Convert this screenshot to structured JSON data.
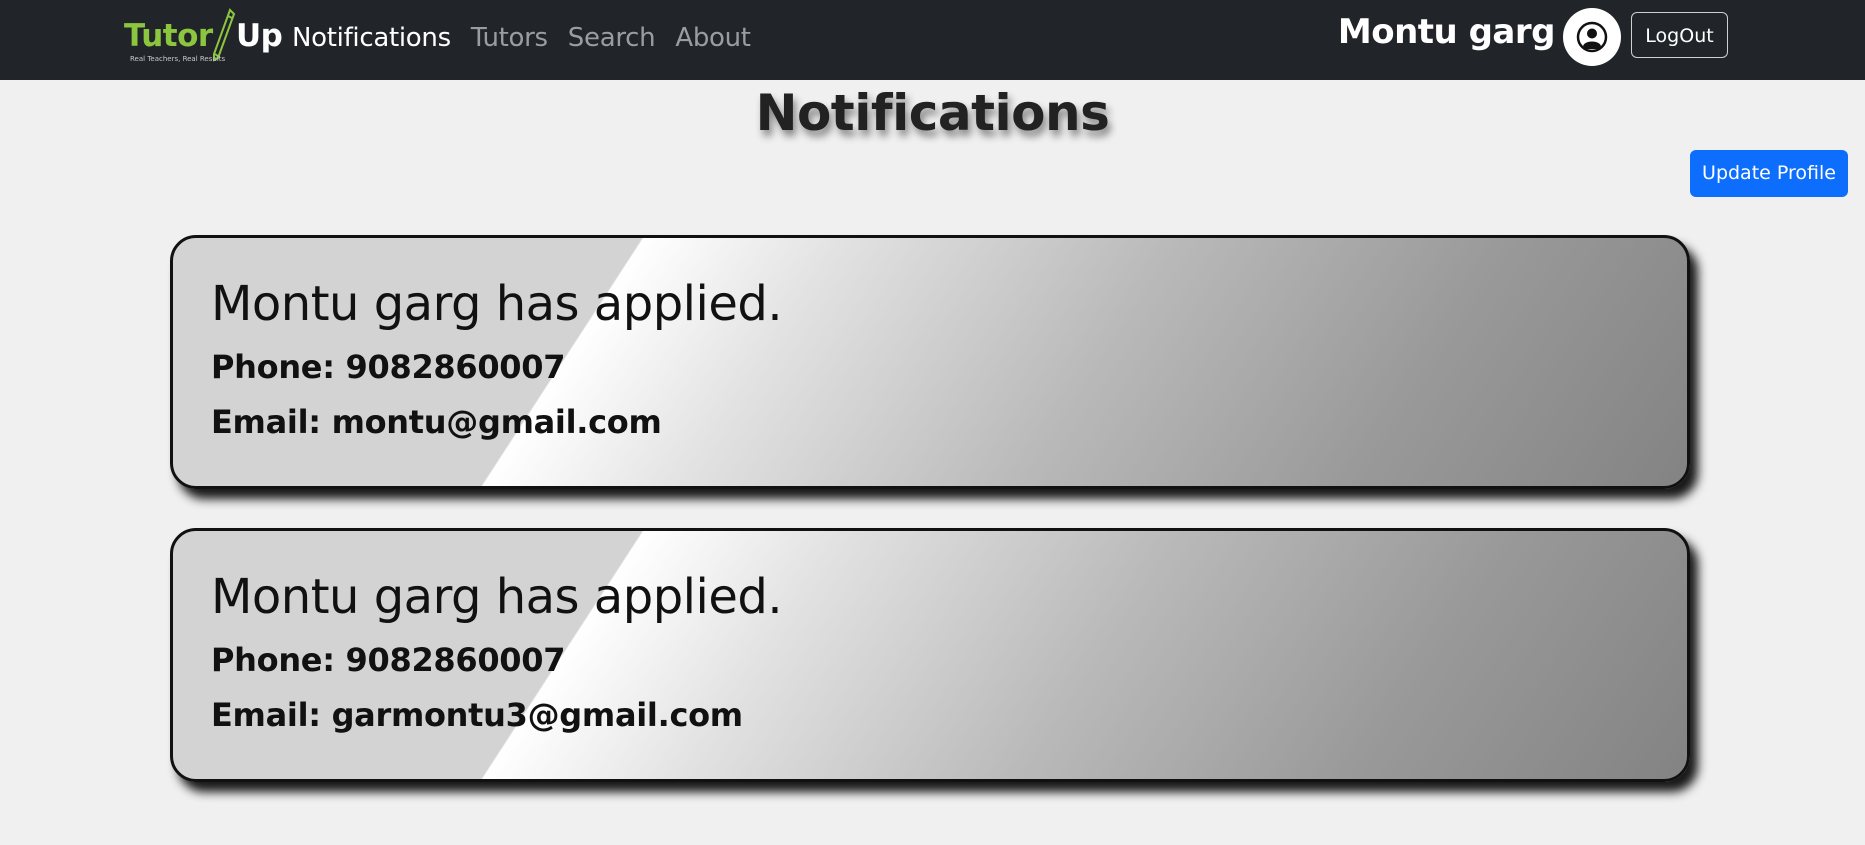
{
  "navbar": {
    "brand": {
      "word1": "Tutor",
      "word2": "Up",
      "tagline": "Real Teachers, Real Results",
      "icon": "pencil-icon",
      "colors": {
        "primary": "#8cc63f",
        "secondary": "#ffffff"
      }
    },
    "links": [
      {
        "label": "Notifications",
        "active": true
      },
      {
        "label": "Tutors",
        "active": false
      },
      {
        "label": "Search",
        "active": false
      },
      {
        "label": "About",
        "active": false
      }
    ],
    "user_name": "Montu garg",
    "avatar_icon": "user-circle-icon",
    "logout_label": "LogOut",
    "background": "#212529"
  },
  "page": {
    "title": "Notifications",
    "update_profile_label": "Update Profile",
    "accent": "#0d6efd"
  },
  "notifications": [
    {
      "heading": "Montu garg has applied.",
      "phone": "Phone: 9082860007",
      "email": "Email: montu@gmail.com"
    },
    {
      "heading": "Montu garg has applied.",
      "phone": "Phone: 9082860007",
      "email": "Email: garmontu3@gmail.com"
    }
  ]
}
